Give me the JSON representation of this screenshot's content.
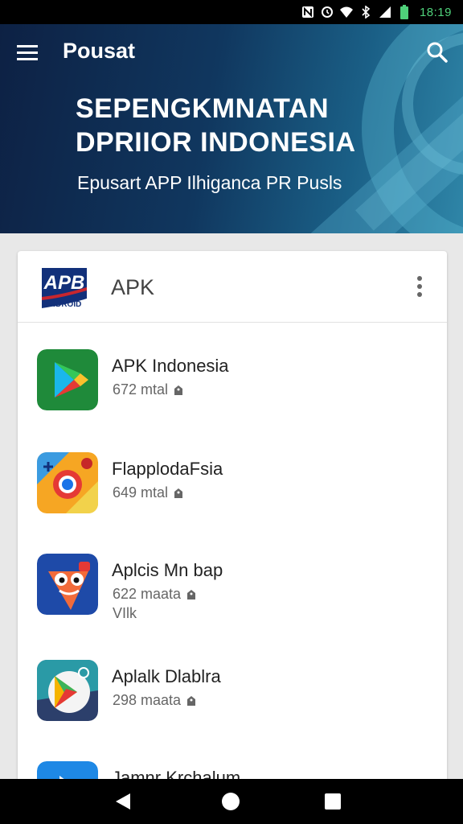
{
  "status_bar": {
    "time": "18:19",
    "icons": [
      "notification-n-icon",
      "alarm-icon",
      "wifi-icon",
      "bluetooth-icon",
      "signal-icon",
      "battery-icon"
    ]
  },
  "header": {
    "title": "Pousat",
    "banner_line1": "SEPENGKMNATAN",
    "banner_line2": "DPRIIOR INDONESIA",
    "banner_subtitle": "Epusart APP Ilhiganca PR Pusls"
  },
  "card": {
    "logo_text_main": "APB",
    "logo_text_sub": "ANDROID",
    "title": "APK",
    "apps": [
      {
        "name": "APK Indonesia",
        "meta": "672 mtal",
        "extra": ""
      },
      {
        "name": "FlapplodaFsia",
        "meta": "649 mtal",
        "extra": ""
      },
      {
        "name": "Aplcis Mn bap",
        "meta": "622 maata",
        "extra": "VIlk"
      },
      {
        "name": "Aplalk Dlablra",
        "meta": "298 maata",
        "extra": ""
      },
      {
        "name": "Jamnr Krchalum",
        "meta": "",
        "extra": ""
      }
    ]
  },
  "colors": {
    "header_dark": "#0d2144",
    "header_light": "#2f86a8",
    "status_time": "#4fd17a"
  },
  "nav": {
    "icons": [
      "back-icon",
      "home-icon",
      "recents-icon"
    ]
  }
}
